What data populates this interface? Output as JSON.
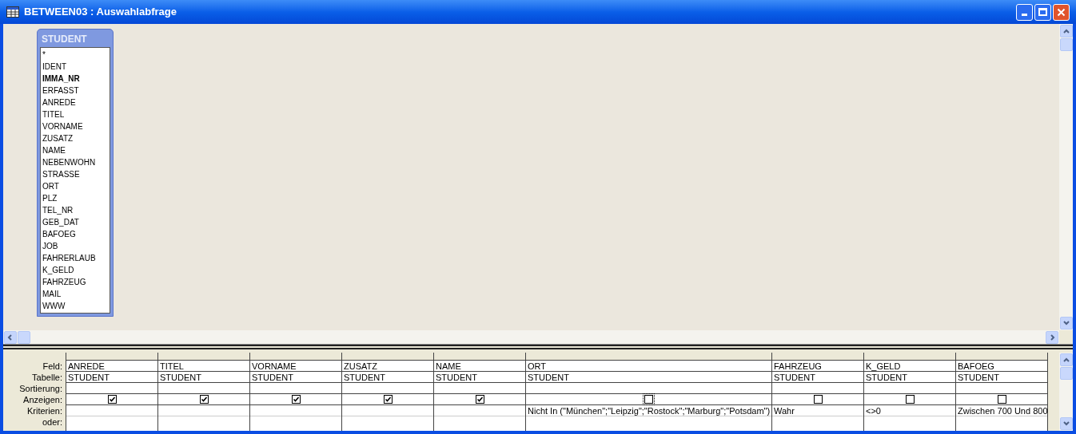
{
  "window": {
    "title": "BETWEEN03 : Auswahlabfrage"
  },
  "field_list": {
    "title": "STUDENT",
    "fields": [
      {
        "name": "*",
        "key": false
      },
      {
        "name": "IDENT",
        "key": false
      },
      {
        "name": "IMMA_NR",
        "key": true
      },
      {
        "name": "ERFASST",
        "key": false
      },
      {
        "name": "ANREDE",
        "key": false
      },
      {
        "name": "TITEL",
        "key": false
      },
      {
        "name": "VORNAME",
        "key": false
      },
      {
        "name": "ZUSATZ",
        "key": false
      },
      {
        "name": "NAME",
        "key": false
      },
      {
        "name": "NEBENWOHN",
        "key": false
      },
      {
        "name": "STRASSE",
        "key": false
      },
      {
        "name": "ORT",
        "key": false
      },
      {
        "name": "PLZ",
        "key": false
      },
      {
        "name": "TEL_NR",
        "key": false
      },
      {
        "name": "GEB_DAT",
        "key": false
      },
      {
        "name": "BAFOEG",
        "key": false
      },
      {
        "name": "JOB",
        "key": false
      },
      {
        "name": "FAHRERLAUB",
        "key": false
      },
      {
        "name": "K_GELD",
        "key": false
      },
      {
        "name": "FAHRZEUG",
        "key": false
      },
      {
        "name": "MAIL",
        "key": false
      },
      {
        "name": "WWW",
        "key": false
      }
    ]
  },
  "grid": {
    "row_labels": [
      "Feld:",
      "Tabelle:",
      "Sortierung:",
      "Anzeigen:",
      "Kriterien:",
      "oder:"
    ],
    "columns": [
      {
        "field": "ANREDE",
        "table": "STUDENT",
        "show": true
      },
      {
        "field": "TITEL",
        "table": "STUDENT",
        "show": true
      },
      {
        "field": "VORNAME",
        "table": "STUDENT",
        "show": true
      },
      {
        "field": "ZUSATZ",
        "table": "STUDENT",
        "show": true
      },
      {
        "field": "NAME",
        "table": "STUDENT",
        "show": true
      },
      {
        "field": "ORT",
        "table": "STUDENT",
        "show": false,
        "criteria": "Nicht In (\"München\";\"Leipzig\";\"Rostock\";\"Marburg\";\"Potsdam\")"
      },
      {
        "field": "FAHRZEUG",
        "table": "STUDENT",
        "show": false,
        "criteria": "Wahr"
      },
      {
        "field": "K_GELD",
        "table": "STUDENT",
        "show": false,
        "criteria": "<>0"
      },
      {
        "field": "BAFOEG",
        "table": "STUDENT",
        "show": false,
        "criteria": "Zwischen 700 Und 800"
      }
    ]
  }
}
